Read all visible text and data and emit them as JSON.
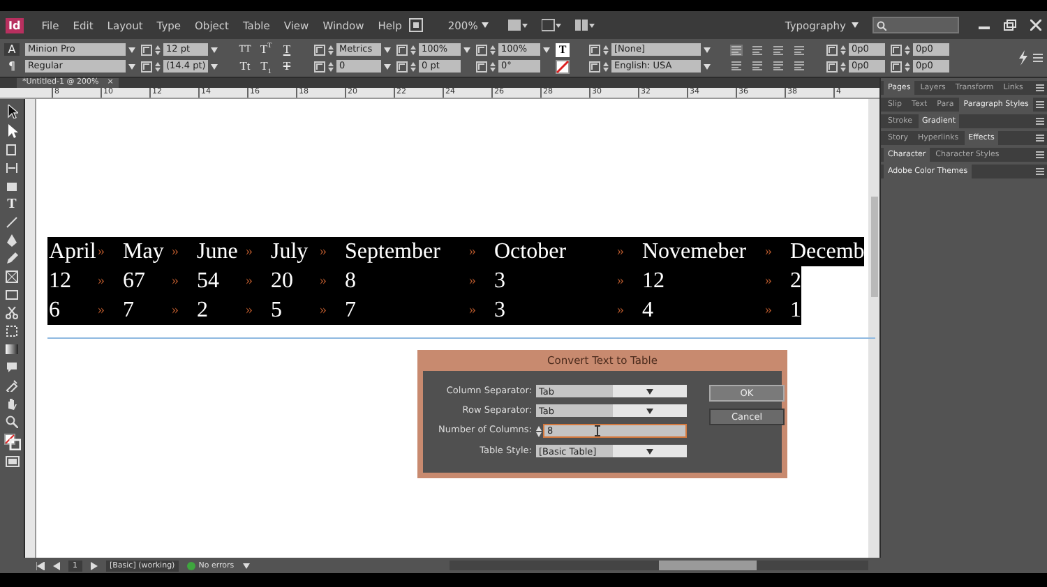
{
  "app": {
    "logo": "Id",
    "menu": [
      "File",
      "Edit",
      "Layout",
      "Type",
      "Object",
      "Table",
      "View",
      "Window",
      "Help"
    ],
    "zoom": "200%",
    "workspace": "Typography"
  },
  "control_panel": {
    "mode_buttons": [
      {
        "label": "A",
        "selected": true
      },
      {
        "label": "¶",
        "selected": false
      }
    ],
    "font_family": "Minion Pro",
    "font_style": "Regular",
    "font_size": "12 pt",
    "leading": "(14.4 pt)",
    "style_buttons": [
      {
        "label": "TT",
        "kind": "caps"
      },
      {
        "label": "T$^{T}$",
        "kind": "plain"
      },
      {
        "label": "T",
        "kind": "underline"
      },
      {
        "label": "Tt",
        "kind": "plain"
      },
      {
        "label": "T$_{1}$",
        "kind": "plain"
      },
      {
        "label": "T",
        "kind": "strike"
      }
    ],
    "kerning": "Metrics",
    "tracking": "0",
    "vertical_scale": "100%",
    "baseline_shift": "0 pt",
    "horizontal_scale": "100%",
    "skew": "0°",
    "fill_glyph": "T",
    "character_style": "[None]",
    "language": "English: USA",
    "indents": [
      "0p0",
      "0p0",
      "0p0",
      "0p0"
    ]
  },
  "document_tab": {
    "title": "*Untitled-1 @ 200%",
    "close": "×"
  },
  "ruler": {
    "labels": [
      "8",
      "10",
      "12",
      "14",
      "16",
      "18",
      "20",
      "22",
      "24",
      "26",
      "28",
      "30",
      "32",
      "34",
      "36",
      "38",
      "4"
    ]
  },
  "toolbox": {
    "type_tool": "T"
  },
  "text_frame": {
    "selected": true,
    "tab_mark": "»",
    "rows": [
      [
        "April",
        "May",
        "June",
        "July",
        "September",
        "October",
        "Novemeber",
        "Decemb"
      ],
      [
        "12",
        "67",
        "54",
        "20",
        "8",
        "3",
        "12",
        "2"
      ],
      [
        "6",
        "7",
        "2",
        "5",
        "7",
        "3",
        "4",
        "1"
      ]
    ]
  },
  "dialog": {
    "title": "Convert Text to Table",
    "fields": [
      {
        "label": "Column Separator:",
        "value": "Tab",
        "kind": "dropdown"
      },
      {
        "label": "Row Separator:",
        "value": "Tab",
        "kind": "dropdown"
      },
      {
        "label": "Number of Columns:",
        "value": "8",
        "kind": "spinner"
      },
      {
        "label": "Table Style:",
        "value": "[Basic Table]",
        "kind": "dropdown"
      }
    ],
    "buttons": [
      {
        "label": "OK",
        "default": true
      },
      {
        "label": "Cancel",
        "default": false
      }
    ]
  },
  "panels": [
    {
      "tabs": [
        {
          "label": "Pages",
          "selected": true
        },
        {
          "label": "Layers",
          "selected": false
        },
        {
          "label": "Transform",
          "selected": false
        },
        {
          "label": "Links",
          "selected": false
        }
      ]
    },
    {
      "tabs": [
        {
          "label": "Slip",
          "selected": false
        },
        {
          "label": "Text",
          "selected": false
        },
        {
          "label": "Para",
          "selected": false
        },
        {
          "label": "Paragraph Styles",
          "selected": true
        }
      ]
    },
    {
      "tabs": [
        {
          "label": "Stroke",
          "selected": false
        },
        {
          "label": "Gradient",
          "selected": true
        }
      ]
    },
    {
      "tabs": [
        {
          "label": "Story",
          "selected": false
        },
        {
          "label": "Hyperlinks",
          "selected": false
        },
        {
          "label": "Effects",
          "selected": true
        }
      ]
    },
    {
      "tabs": [
        {
          "label": "Character",
          "selected": true
        },
        {
          "label": "Character Styles",
          "selected": false
        }
      ]
    },
    {
      "tabs": [
        {
          "label": "Adobe Color Themes",
          "selected": true
        }
      ]
    }
  ],
  "status_bar": {
    "page": "1",
    "master": "[Basic] (working)",
    "preflight": "No errors"
  }
}
